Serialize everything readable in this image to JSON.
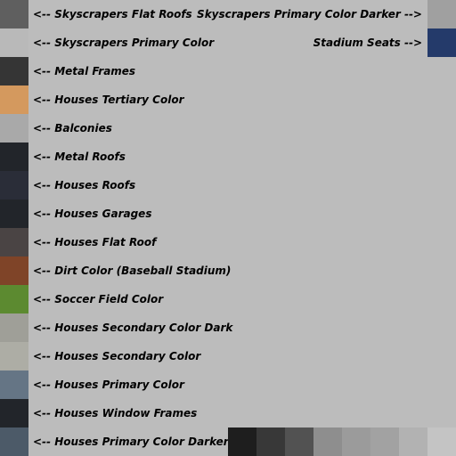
{
  "left_items": [
    {
      "label": "<-- Skyscrapers Flat Roofs",
      "color": "#5f5f5f"
    },
    {
      "label": "<-- Skyscrapers Primary Color",
      "color": "#b9b9b9"
    },
    {
      "label": "<-- Metal Frames",
      "color": "#353535"
    },
    {
      "label": "<-- Houses Tertiary Color",
      "color": "#d4995e"
    },
    {
      "label": "<-- Balconies",
      "color": "#a9a9a9"
    },
    {
      "label": "<-- Metal Roofs",
      "color": "#22252a"
    },
    {
      "label": "<-- Houses Roofs",
      "color": "#2a2d38"
    },
    {
      "label": "<-- Houses Garages",
      "color": "#22252a"
    },
    {
      "label": "<-- Houses Flat Roof",
      "color": "#4a4444"
    },
    {
      "label": "<-- Dirt Color (Baseball Stadium)",
      "color": "#7f4428"
    },
    {
      "label": "<-- Soccer Field Color",
      "color": "#5c8a30"
    },
    {
      "label": "<-- Houses Secondary Color Dark",
      "color": "#9f9f98"
    },
    {
      "label": "<-- Houses Secondary Color",
      "color": "#adada5"
    },
    {
      "label": "<-- Houses Primary Color",
      "color": "#657585"
    },
    {
      "label": "<-- Houses Window Frames",
      "color": "#22252a"
    },
    {
      "label": "<-- Houses Primary Color Darker",
      "color": "#4c5a68"
    }
  ],
  "right_items": [
    {
      "label": "Skyscrapers Primary Color Darker -->",
      "color": "#a0a0a0"
    },
    {
      "label": "Stadium Seats -->",
      "color": "#243a6a"
    }
  ],
  "bottom_swatches": [
    {
      "color": "#1e1e1e"
    },
    {
      "color": "#383838"
    },
    {
      "color": "#525252"
    },
    {
      "color": "#8e8e8e"
    },
    {
      "color": "#9b9b9b"
    },
    {
      "color": "#a2a2a2"
    },
    {
      "color": "#b2b2b2"
    },
    {
      "color": "#c4c4c4"
    }
  ]
}
